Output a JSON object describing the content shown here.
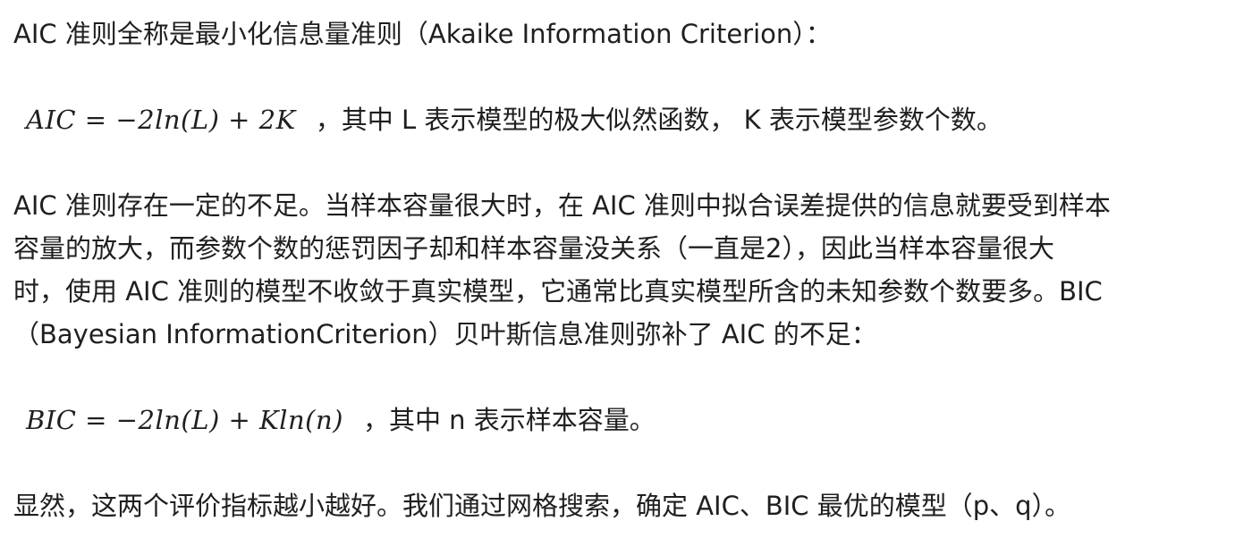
{
  "paragraph_1": "AIC 准则全称是最小化信息量准则（Akaike Information Criterion）：",
  "formula_aic": {
    "math": "AIC = −2ln(L) + 2K",
    "text": "，其中 L 表示模型的极大似然函数， K 表示模型参数个数。"
  },
  "paragraph_2": {
    "lines": [
      "AIC 准则存在一定的不足。当样本容量很大时，在 AIC 准则中拟合误差提供的信息就要受到样本",
      "容量的放大，而参数个数的惩罚因子却和样本容量没关系（一直是2），因此当样本容量很大",
      "时，使用 AIC 准则的模型不收敛于真实模型，它通常比真实模型所含的未知参数个数要多。BIC",
      "（Bayesian InformationCriterion）贝叶斯信息准则弥补了 AIC 的不足："
    ]
  },
  "formula_bic": {
    "math": "BIC = −2ln(L) + Kln(n)",
    "text": "，其中 n 表示样本容量。"
  },
  "paragraph_3": "显然，这两个评价指标越小越好。我们通过网格搜索，确定 AIC、BIC 最优的模型（p、q）。"
}
